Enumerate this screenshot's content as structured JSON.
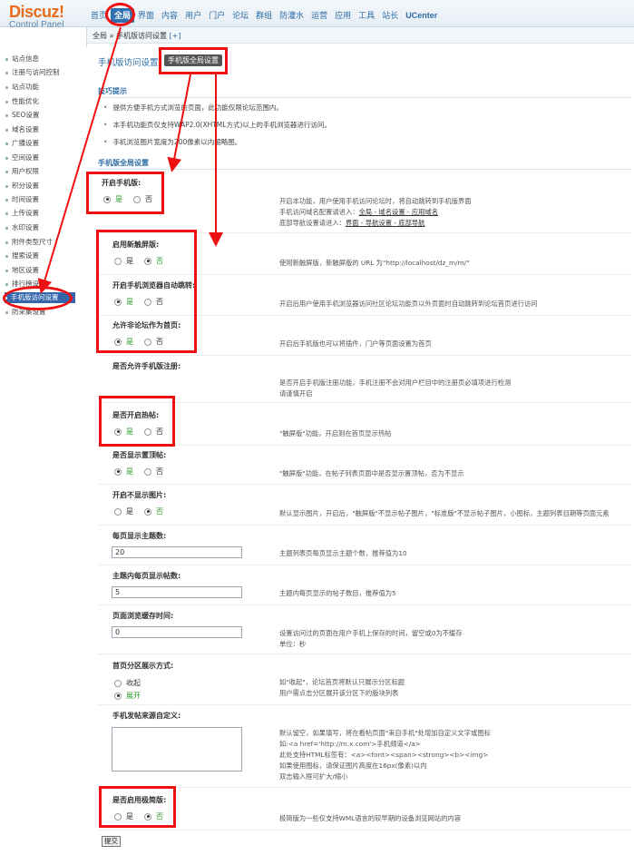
{
  "logo": {
    "main": "Discuz!",
    "sub": "Control Panel"
  },
  "nav": {
    "items": [
      "首页",
      "全局",
      "界面",
      "内容",
      "用户",
      "门户",
      "论坛",
      "群组",
      "防灌水",
      "运营",
      "应用",
      "工具",
      "站长",
      "UCenter"
    ]
  },
  "sidebar": {
    "items": [
      "站点信息",
      "注册与访问控制",
      "站点功能",
      "性能优化",
      "SEO设置",
      "域名设置",
      "广播设置",
      "空间设置",
      "用户权限",
      "积分设置",
      "时间设置",
      "上传设置",
      "水印设置",
      "附件类型尺寸",
      "搜索设置",
      "地区设置",
      "排行榜设置",
      "手机版访问设置",
      "防采集设置"
    ],
    "active_index": 17
  },
  "breadcrumb": {
    "path": "全局 » 手机版访问设置",
    "plus": "[+]"
  },
  "page": {
    "title": "手机版访问设置",
    "tab_button": "手机版全局设置"
  },
  "tips": {
    "heading": "技巧提示",
    "items": [
      "提供方便手机方式浏览的页面，此功能仅限论坛范围内。",
      "本手机功能页仅支持WAP2.0(XHTML方式)以上的手机浏览器进行访问。",
      "手机浏览图片宽度为200像素以内缩略图。"
    ]
  },
  "settings_heading": "手机版全局设置",
  "settings": [
    {
      "label": "开启手机版:",
      "yes": "是",
      "no": "否",
      "selected": "yes",
      "desc": [
        "开启本功能，用户使用手机访问论坛时，将自动跳转到手机版界面",
        "手机访问域名配置请进入：",
        "底部导航设置请进入："
      ],
      "links1": "全局 - 域名设置 - 应用域名",
      "links2": "界面 - 导航设置 - 底部导航"
    },
    {
      "label": "启用新触屏版:",
      "yes": "是",
      "no": "否",
      "selected": "no",
      "desc": [
        "使用新触屏版，新触屏版的 URL 为\"http://localhost/dz_m/m/\""
      ]
    },
    {
      "label": "开启手机浏览器自动跳转:",
      "yes": "是",
      "no": "否",
      "selected": "yes",
      "desc": [
        "开启后用户使用手机浏览器访问社区论坛功能页以外页面时自动跳转到论坛首页进行访问"
      ]
    },
    {
      "label": "允许非论坛作为首页:",
      "yes": "是",
      "no": "否",
      "selected": "yes",
      "desc": [
        "开启后手机版也可以将插件，门户等页面设置为首页"
      ]
    },
    {
      "label": "是否允许手机版注册:",
      "yes": "是",
      "no": "否",
      "selected": "none",
      "desc": [
        "是否开启手机版注册功能，手机注册不会对用户栏目中的注册页必填项进行检测",
        "请谨慎开启"
      ]
    },
    {
      "label": "是否开启热帖:",
      "yes": "是",
      "no": "否",
      "selected": "yes",
      "desc": [
        "\"触屏版\"功能，开启则在首页显示热帖"
      ]
    },
    {
      "label": "是否显示置顶帖:",
      "yes": "是",
      "no": "否",
      "selected": "yes",
      "desc": [
        "\"触屏版\"功能，在帖子列表页面中是否显示置顶帖，否为不显示"
      ]
    },
    {
      "label": "开启不显示图片:",
      "yes": "是",
      "no": "否",
      "selected": "no",
      "desc": [
        "默认显示图片，开启后，\"触屏版\"不显示帖子图片，\"标准版\"不显示帖子图片，小图标，主题列表目期等页面元素"
      ]
    }
  ],
  "inputs": [
    {
      "label": "每页显示主题数:",
      "value": "20",
      "desc": [
        "主题列表页每页显示主题个数，推荐值为10"
      ]
    },
    {
      "label": "主题内每页显示帖数:",
      "value": "5",
      "desc": [
        "主题内每页显示的帖子数目，推荐值为5"
      ]
    },
    {
      "label": "页面浏览缓存时间:",
      "value": "0",
      "desc": [
        "设置访问过的页面在用户手机上保存的时间，留空或0为不缓存",
        "单位：秒"
      ]
    }
  ],
  "partition": {
    "label": "首页分区展示方式:",
    "opt1": "收起",
    "opt2": "展开",
    "selected": "opt2",
    "desc": [
      "如\"收起\"，论坛首页将默认只展示分区标题",
      "用户需点击分区展开该分区下的版块列表"
    ]
  },
  "source": {
    "label": "手机发帖来源自定义:",
    "value": "",
    "desc": [
      "默认留空，如果填写，将在看帖页面\"来自手机\"处增加自定义文字或图标",
      "如:<a href='http://m.x.com'>手机频道</a>",
      "此处支持HTML标签有：<a><font><span><strong><b><img>",
      "如果使用图标，请保证图片高度在16px(像素)以内",
      "双击输入框可扩大/缩小"
    ]
  },
  "simple": {
    "label": "是否启用极简版:",
    "yes": "是",
    "no": "否",
    "selected": "no",
    "desc": [
      "极简版为一些仅支持WML语言的较早期的设备浏览网站的内容"
    ]
  },
  "submit_label": "提交",
  "colors": {
    "accent": "#2e6da4",
    "annotation": "#e11111",
    "selected_green": "#2a9a2a"
  }
}
